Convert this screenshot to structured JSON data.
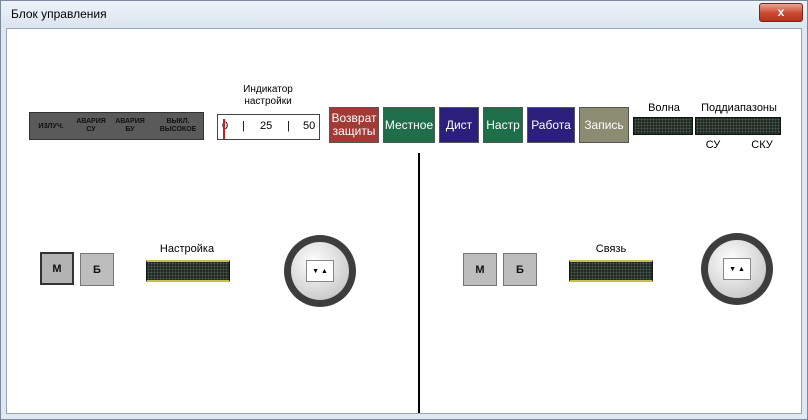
{
  "window": {
    "title": "Блок управления",
    "close_label": "x"
  },
  "status_panel": {
    "items": [
      "ИЗЛУЧ.",
      "АВАРИЯ СУ",
      "АВАРИЯ БУ",
      "ВЫКЛ. ВЫСОКОЕ"
    ]
  },
  "indicator": {
    "title_line1": "Индикатор",
    "title_line2": "настройки",
    "scale": [
      "0",
      "|",
      "25",
      "|",
      "50"
    ]
  },
  "buttons": {
    "vozvrat": "Возврат защиты",
    "mestnoe": "Местное",
    "dist": "Дист",
    "nastr": "Настр",
    "rabota": "Работа",
    "zapis": "Запись"
  },
  "right_header": {
    "volna": "Волна",
    "podd": "Поддиапазоны",
    "su": "СУ",
    "sku": "СКУ"
  },
  "left_panel": {
    "label": "Настройка",
    "m": "М",
    "b": "Б",
    "knob_arrows": "▼ ▲"
  },
  "right_panel": {
    "label": "Связь",
    "m": "М",
    "b": "Б",
    "knob_arrows": "▼ ▲"
  },
  "colors": {
    "vozvrat": "#a33a35",
    "mestnoe": "#1f6e4a",
    "dist": "#2a1f7a",
    "nastr": "#1f6e4a",
    "rabota": "#2a1f7a",
    "zapis": "#8c8c72"
  }
}
